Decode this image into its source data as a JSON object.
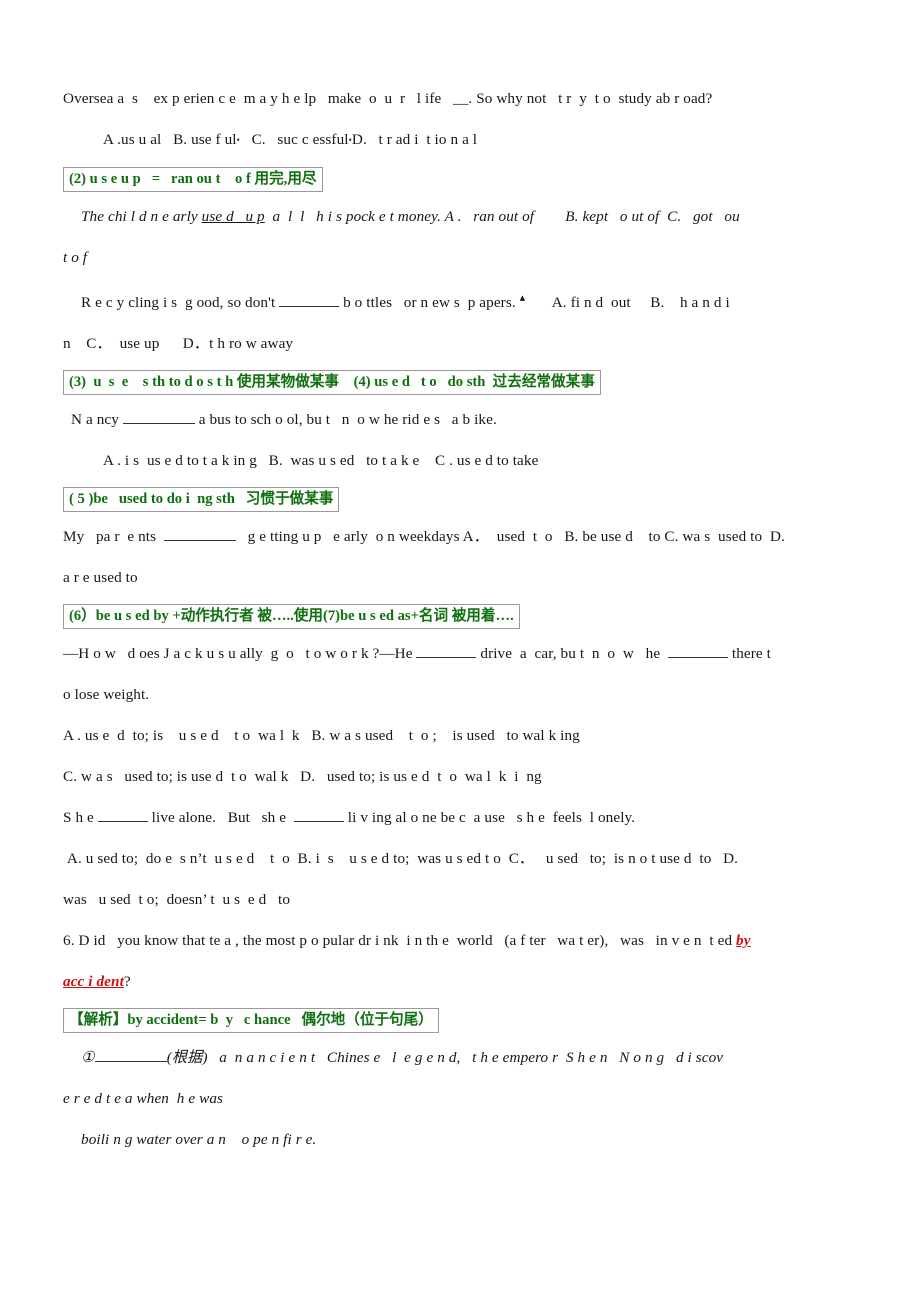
{
  "document": {
    "type": "scanned-english-grammar-worksheet",
    "page_background": "#ffffff",
    "accent_green": "#107010",
    "accent_red": "#d01010",
    "box_border": "#9a9a9a"
  },
  "lines": {
    "q1_stem": "Oversea a  s    ex p erien c e  m a y h e lp   make  o  u  r   l ife   __. So why not   t r  y  t o  study ab r oad?",
    "q1_options_pre": "A .us u al   B. use f ul",
    "q1_options_mid": "   C.   suc c essful",
    "q1_options_post": "D.   t r ad i  t io n a l",
    "box2": "(2) u s e u p   =   ran ou t    o f 用完,用尽",
    "q2_stem_a": "The chi l d n e arly ",
    "q2_stem_underline": "use d   u p",
    "q2_stem_b": "  a  l  l   h i s pock e t money. A .   ran out of        B. kept   o ut of  C.   got   ou",
    "q2_stem_wrap": "t o f",
    "q3_stem": "R e c y cling i s  g ood, so don't ",
    "q3_stem_b": " b o ttles   or n ew s  p apers. ",
    "q3_options_a": "       A. fi n d  out     B.    h a n d i",
    "q3_options_wrap": "n    C．  use up      D．t h ro w away",
    "box34": "(3)  u  s  e    s th to d o s t h 使用某物做某事    (4) us e d   t o   do sth  过去经常做某事",
    "q4_stem_a": "N a ncy ",
    "q4_stem_b": " a bus to sch o ol, bu t   n  o w he rid e s   a b ike.",
    "q4_options": "A . i s  us e d to t a k in g   B.  was u s ed   to t a k e    C . us e d to take",
    "box5": "( 5 )be   used to do i  ng sth   习惯于做某事",
    "q5_stem_a": "My   pa r  e nts  ",
    "q5_stem_b": "   g e tting u p   e arly  o n weekdays A．  used  t  o   B. be use d    to C. wa s  used to  D.",
    "q5_stem_wrap": "a r e used to",
    "box67": "(6）be u s ed by +动作执行者 被…..使用(7)be u s ed as+名词 被用着….",
    "q6_stem_a": "—H o w   d oes J a c k u s u ally  g  o   t o w o r k ?—He ",
    "q6_stem_b": " drive  a  car, bu t  n  o  w   he  ",
    "q6_stem_c": " there t",
    "q6_stem_wrap": "o lose weight.",
    "q6_option_ab": "A . us e  d  to; is    u s e d    t o  wa l  k   B. w a s used    t  o ;    is used   to wal k ing",
    "q6_option_cd": "C. w a s   used to; is use d  t o  wal k   D.   used to; is us e d  t  o  wa l  k  i  ng",
    "q7_stem_a": "S h e ",
    "q7_stem_b": " live alone.   But   sh e  ",
    "q7_stem_c": " li v ing al o ne be c  a use   s h e  feels  l onely.",
    "q7_options": " A. u sed to;  do e  s n’t  u s e d    t  o  B. i  s    u s e d to;  was u s ed t o  C．   u sed   to;  is n o t use d  to   D.",
    "q7_options_wrap": "was   u sed  t o;  doesn’ t  u s  e d   to",
    "q8_stem_a": "6. D id   you know that te a , the most p o pular dr i nk  i n th e  world   (a f ter   wa t er),   was   in v e n  t ed ",
    "q8_stem_red1": "by",
    "q8_stem_red2": "acc i dent",
    "q8_stem_tail": "?",
    "box_analysis": "【解析】by accident= b  y   c hance   偶尔地（位于句尾）",
    "q9_stem_a": "①",
    "q9_stem_b": "(根据)   a  n a n c i e n t   Chines e   l  e g e n d,   t h e empero r  S h e n   N o n g   d i scov",
    "q9_stem_wrap": "e r e d t e a when  h e was",
    "q9_stem_wrap2": "boili n g water over a n    o pe n fi r e."
  }
}
